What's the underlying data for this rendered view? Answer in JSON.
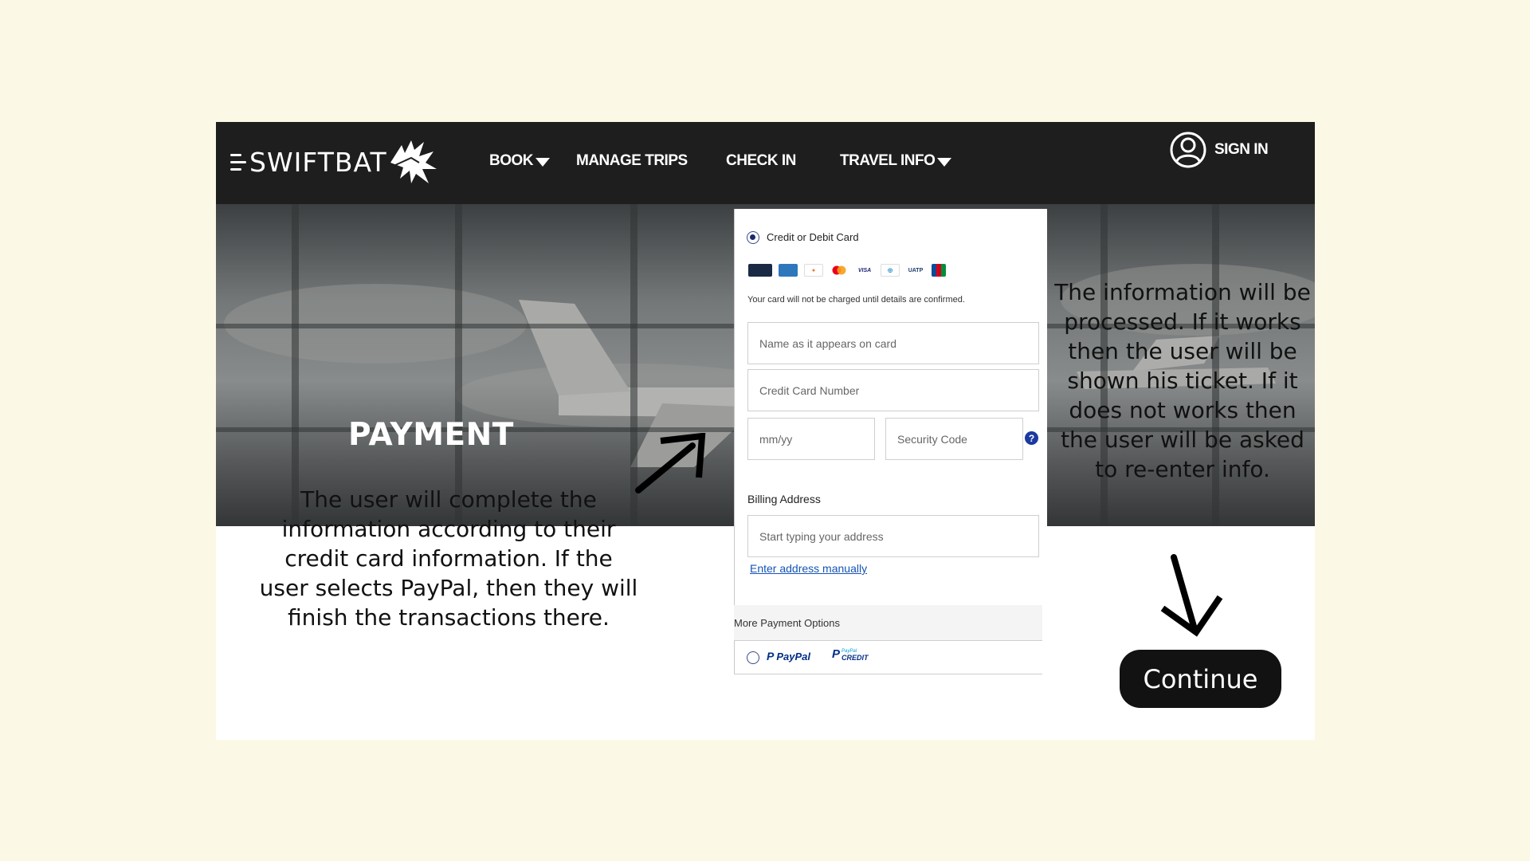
{
  "nav": {
    "brand": "SWIFTBAT",
    "items": [
      {
        "label": "BOOK",
        "has_dropdown": true
      },
      {
        "label": "MANAGE TRIPS",
        "has_dropdown": false
      },
      {
        "label": "CHECK IN",
        "has_dropdown": false
      },
      {
        "label": "TRAVEL INFO",
        "has_dropdown": true
      }
    ],
    "sign_in": "SIGN IN",
    "icons": {
      "logo": "bat-icon",
      "user": "user-icon",
      "dropdown": "caret-down-icon"
    }
  },
  "hero": {
    "title": "PAYMENT"
  },
  "annotations": {
    "left": "The user will complete the information according to their credit card information. If the user selects PayPal, then they will finish the transactions there.",
    "right": "The information will be processed. If it works then the user will be shown his ticket. If it does not works then the user will be asked to re-enter info."
  },
  "payment_form": {
    "method_label": "Credit or Debit Card",
    "card_brands": [
      "card",
      "amex",
      "discover",
      "mastercard",
      "VISA",
      "diners",
      "UATP",
      "JCB"
    ],
    "note": "Your card will not be charged until details are confirmed.",
    "fields": {
      "name_placeholder": "Name as it appears on card",
      "card_number_placeholder": "Credit Card Number",
      "expiry_placeholder": "mm/yy",
      "security_placeholder": "Security Code"
    },
    "help_icon": "?",
    "billing_label": "Billing Address",
    "address_placeholder": "Start typing your address",
    "manual_link": "Enter address manually",
    "more_options": "More Payment Options",
    "paypal_label": "PayPal",
    "paypal_credit_label": "CREDIT",
    "paypal_credit_small": "PayPal"
  },
  "continue_button": "Continue",
  "colors": {
    "page_bg": "#fcf8e6",
    "nav_bg": "#1e1e1e",
    "link": "#1554b5",
    "paypal_dark": "#003087",
    "paypal_light": "#009cde",
    "button_bg": "#121212"
  }
}
